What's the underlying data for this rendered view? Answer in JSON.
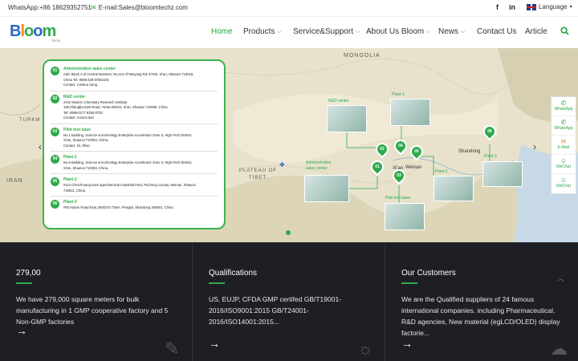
{
  "topbar": {
    "whatsapp": "WhatsApp:+86 18629352751",
    "email": "E-mail:Sales@bloomtechz.com",
    "facebook": "f",
    "linkedin": "in",
    "language": "Language"
  },
  "logo": {
    "b": "B",
    "l": "l",
    "o1": "o",
    "o2": "o",
    "m": "m",
    "sub": "TECH"
  },
  "nav": {
    "items": [
      {
        "label": "Home",
        "active": true
      },
      {
        "label": "Products",
        "dropdown": true
      },
      {
        "label": "Service&Support",
        "dropdown": true
      },
      {
        "label": "About Us Bloom",
        "dropdown": true
      },
      {
        "label": "News",
        "dropdown": true
      },
      {
        "label": "Contact Us"
      },
      {
        "label": "Article"
      }
    ],
    "search_icon": "search-icon"
  },
  "map": {
    "regions": {
      "mongolia": "MONGOLIA",
      "iran": "IRAN",
      "turkmen": "TURKM",
      "plateau1": "PLATEAU OF",
      "plateau2": "TIBET"
    },
    "cities": {
      "xian": "Xi'an",
      "weinan": "Weinan",
      "shandong": "Shandong"
    },
    "entries": [
      {
        "num": "01",
        "title": "Administrative sales center",
        "lines": [
          "Add: Block A of Central Mansion, No.113 of Weiyang Rd, ETDZ, Xi'an, Shaanxi 710016,",
          "China Tel: 0086 029 87564101",
          "Contact: Cristina Song"
        ]
      },
      {
        "num": "02",
        "title": "R&D center",
        "lines": [
          "Xi'an Modern Chemistry Research Institute",
          "168 Zhangba East Road, Yanta District, Xi'an, Shaanxi 710065, China",
          "Tel: 0086-0177 8258 8703",
          "Contact: Aurora Nan"
        ]
      },
      {
        "num": "03",
        "title": "Pilot test base",
        "lines": [
          "No.1 Building, Science & technology Enterprise Accelerator Zone II, High-Tech District,",
          "Xi'an, Shaanxi 710304, China.",
          "Contact: Dr. Zhao"
        ]
      },
      {
        "num": "04",
        "title": "Plant-1",
        "lines": [
          "No.6 Building, Science & technology Enterprise Accelerator Zone II, High-Tech District,",
          "Xi'an, Shaanxi 710304, China."
        ]
      },
      {
        "num": "05",
        "title": "Plant-2",
        "lines": [
          "#113 Chenzhuang town agrochemical Industrial Park, Pucheng County, Weinan, Shaanxi",
          "715511, China."
        ]
      },
      {
        "num": "06",
        "title": "Plant-3",
        "lines": [
          "#93  Haitun Road East, BEIGOU Town, Penglai, Shandong 265601, China."
        ]
      }
    ],
    "photos": {
      "rd": "R&D center",
      "plant1": "Plant-1",
      "admin1": "Administrative",
      "admin2": "sales center",
      "pilot": "Pilot test base",
      "plant2": "Plant-2",
      "plant3": "Plant-3"
    },
    "pins": [
      "02",
      "04",
      "05",
      "01",
      "03",
      "06"
    ]
  },
  "sidebar": [
    {
      "icon": "whatsapp-icon",
      "label": "WhatsApp"
    },
    {
      "icon": "whatsapp-icon",
      "label": "WhatsApp"
    },
    {
      "icon": "mail-icon",
      "label": "E-Mail"
    },
    {
      "icon": "wechat-icon",
      "label": "WeChat"
    },
    {
      "icon": "wechat-icon",
      "label": "WeChat"
    }
  ],
  "bottom": [
    {
      "title": "279,00",
      "desc": "We have 279,000 square meters for bulk manufacturing in 1 GMP cooperative factory and 5 Non-GMP factories"
    },
    {
      "title": "Qualifications",
      "desc": "US, EUJP, CFDA GMP certifed GB/T19001-2016/ISO9001:2015 GB/T24001-2016/ISO14001:2015..."
    },
    {
      "title": "Our Customers",
      "desc": "We are the Qualified suppliers of 24 famous international companies. including Pharmaceutical. R&D agencies, New material (egLCD/OLED) display factorie..."
    }
  ],
  "colors": {
    "accent": "#2faa4b",
    "dark": "#1e1f24"
  }
}
